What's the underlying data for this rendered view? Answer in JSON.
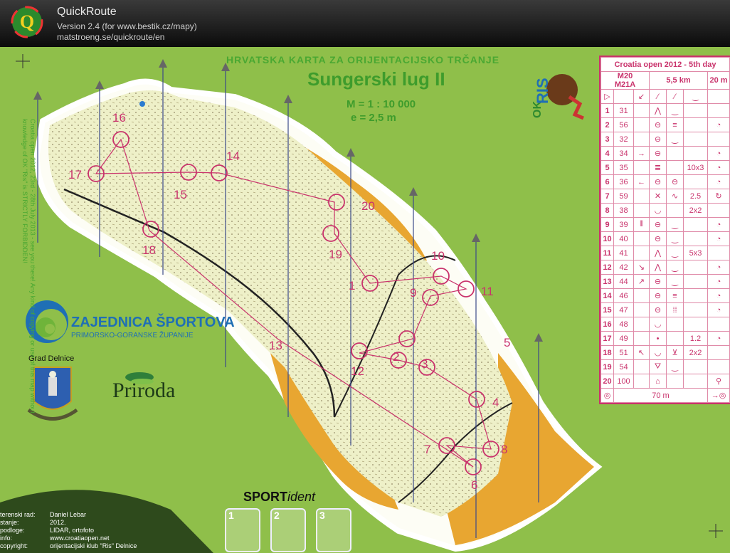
{
  "app": {
    "name": "QuickRoute",
    "version": "Version 2.4  (for www.bestik.cz/mapy)",
    "url": "matstroeng.se/quickroute/en",
    "logo_icon": "quickroute-q-logo"
  },
  "map": {
    "header": "HRVATSKA KARTA ZA ORIJENTACIJSKO TRČANJE",
    "title": "Sungerski lug II",
    "scale": "M = 1 : 10 000",
    "equidistance": "e = 2,5 m",
    "copyright_note": "Croatia open 2012, 23rd - 28th July 2013 - see you there! Any kind of copying or use of this map without knowledge of OK \"Ris\" is STRICTLY FORBIDDEN!",
    "club_logo_text": "OK RIS",
    "sponsor": {
      "name": "ZAJEDNICA ŠPORTOVA",
      "subtitle": "PRIMORSKO-GORANSKE ŽUPANIJE"
    },
    "town": "Grad Delnice",
    "priroda": "Priroda",
    "sportident": {
      "brand": "SPORT",
      "suffix": "ident"
    },
    "si_cards": [
      "1",
      "2",
      "3"
    ],
    "controls": [
      "1",
      "2",
      "3",
      "4",
      "5",
      "6",
      "7",
      "8",
      "9",
      "10",
      "11",
      "12",
      "13",
      "14",
      "15",
      "16",
      "17",
      "18",
      "19",
      "20"
    ],
    "credits": [
      {
        "k": "terenski rad:",
        "v": "Daniel Lebar"
      },
      {
        "k": "stanje:",
        "v": "2012."
      },
      {
        "k": "podloge:",
        "v": "LIDAR, ortofoto"
      },
      {
        "k": "info:",
        "v": "www.croatiaopen.net"
      },
      {
        "k": "copyright:",
        "v": "orijentacijski klub \"Ris\" Delnice"
      }
    ],
    "colors": {
      "course": "#c9336c",
      "land": "#eef0c8",
      "forest": "#e8a631",
      "background": "#8fbf4a"
    }
  },
  "description": {
    "event": "Croatia open 2012 - 5th day",
    "class": [
      "M20",
      "M21A"
    ],
    "length": "5,5 km",
    "climb": "20 m",
    "rows": [
      {
        "n": "1",
        "code": "31",
        "c": [
          "",
          "⋀",
          "‿",
          "",
          ""
        ]
      },
      {
        "n": "2",
        "code": "56",
        "c": [
          "",
          "⊖",
          "≡",
          "",
          "◔"
        ]
      },
      {
        "n": "3",
        "code": "32",
        "c": [
          "",
          "⊖",
          "‿",
          "",
          ""
        ]
      },
      {
        "n": "4",
        "code": "34",
        "c": [
          "→",
          "⊖",
          "",
          "",
          "◔"
        ]
      },
      {
        "n": "5",
        "code": "35",
        "c": [
          "",
          "≣",
          "",
          "10x3",
          "◔"
        ]
      },
      {
        "n": "6",
        "code": "36",
        "c": [
          "←",
          "⊖",
          "⊖",
          "",
          "◔"
        ]
      },
      {
        "n": "7",
        "code": "59",
        "c": [
          "",
          "✕",
          "∿",
          "2.5",
          "↻"
        ]
      },
      {
        "n": "8",
        "code": "38",
        "c": [
          "",
          "◡",
          "",
          "2x2",
          ""
        ]
      },
      {
        "n": "9",
        "code": "39",
        "c": [
          "⫴",
          "⊖",
          "‿",
          "",
          "◔"
        ]
      },
      {
        "n": "10",
        "code": "40",
        "c": [
          "",
          "⊖",
          "‿",
          "",
          "◔"
        ]
      },
      {
        "n": "11",
        "code": "41",
        "c": [
          "",
          "⋀",
          "‿",
          "5x3",
          ""
        ]
      },
      {
        "n": "12",
        "code": "42",
        "c": [
          "↘",
          "⋀",
          "‿",
          "",
          "◔"
        ]
      },
      {
        "n": "13",
        "code": "44",
        "c": [
          "↗",
          "⊖",
          "‿",
          "",
          "◔"
        ]
      },
      {
        "n": "14",
        "code": "46",
        "c": [
          "",
          "⊖",
          "≡",
          "",
          "◔"
        ]
      },
      {
        "n": "15",
        "code": "47",
        "c": [
          "",
          "⊖",
          "⁞⁞",
          "",
          "◔"
        ]
      },
      {
        "n": "16",
        "code": "48",
        "c": [
          "",
          "◡",
          "",
          "",
          ""
        ]
      },
      {
        "n": "17",
        "code": "49",
        "c": [
          "",
          "•",
          "",
          "1.2",
          "◔"
        ]
      },
      {
        "n": "18",
        "code": "51",
        "c": [
          "↖",
          "◡",
          "⊻",
          "2x2",
          ""
        ]
      },
      {
        "n": "19",
        "code": "54",
        "c": [
          "",
          "⛛",
          "‿",
          "",
          ""
        ]
      },
      {
        "n": "20",
        "code": "100",
        "c": [
          "",
          "⌂",
          "",
          "",
          "⚲"
        ]
      }
    ],
    "finish_distance": "70 m"
  }
}
